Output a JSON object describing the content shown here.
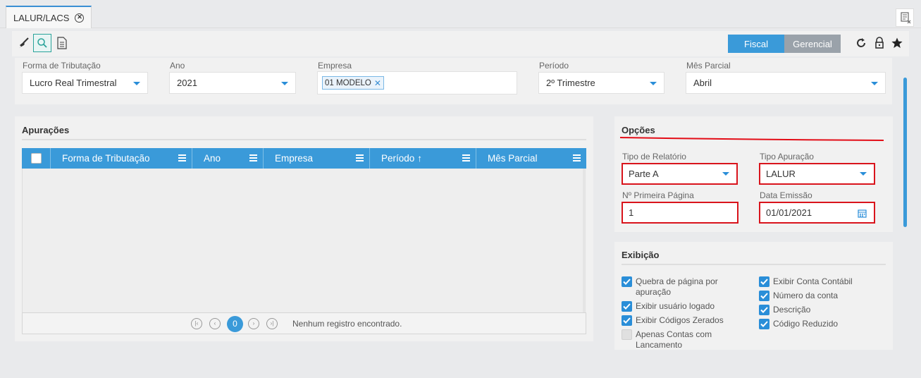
{
  "tab": {
    "title": "LALUR/LACS"
  },
  "toolbar": {
    "fiscal_label": "Fiscal",
    "gerencial_label": "Gerencial",
    "accent": "#3a9ad9",
    "inactive": "#9aa2aa"
  },
  "filters": {
    "forma": {
      "label": "Forma de Tributação",
      "value": "Lucro Real Trimestral"
    },
    "ano": {
      "label": "Ano",
      "value": "2021"
    },
    "empresa": {
      "label": "Empresa",
      "chip": "01 MODELO"
    },
    "periodo": {
      "label": "Período",
      "value": "2º Trimestre"
    },
    "mes": {
      "label": "Mês Parcial",
      "value": "Abril"
    }
  },
  "apuracoes": {
    "title": "Apurações",
    "columns": [
      "Forma de Tributação",
      "Ano",
      "Empresa",
      "Período",
      "Mês Parcial"
    ],
    "sorted_column": "Período",
    "rows": [],
    "pager": {
      "current_page": "0",
      "empty_message": "Nenhum registro encontrado."
    }
  },
  "opcoes": {
    "title": "Opções",
    "tipo_relatorio": {
      "label": "Tipo de Relatório",
      "value": "Parte A"
    },
    "tipo_apuracao": {
      "label": "Tipo Apuração",
      "value": "LALUR"
    },
    "primeira_pagina": {
      "label": "Nº Primeira Página",
      "value": "1"
    },
    "data_emissao": {
      "label": "Data Emissão",
      "value": "01/01/2021"
    },
    "highlight_color": "#d9141c"
  },
  "exibicao": {
    "title": "Exibição",
    "left": [
      {
        "label": "Quebra de página por apuração",
        "checked": true
      },
      {
        "label": "Exibir usuário logado",
        "checked": true
      },
      {
        "label": "Exibir Códigos Zerados",
        "checked": true
      },
      {
        "label": "Apenas Contas com Lancamento",
        "checked": false
      }
    ],
    "right": [
      {
        "label": "Exibir Conta Contábil",
        "checked": true
      },
      {
        "label": "Número da conta",
        "checked": true
      },
      {
        "label": "Descrição",
        "checked": true
      },
      {
        "label": "Código Reduzido",
        "checked": true
      }
    ]
  }
}
